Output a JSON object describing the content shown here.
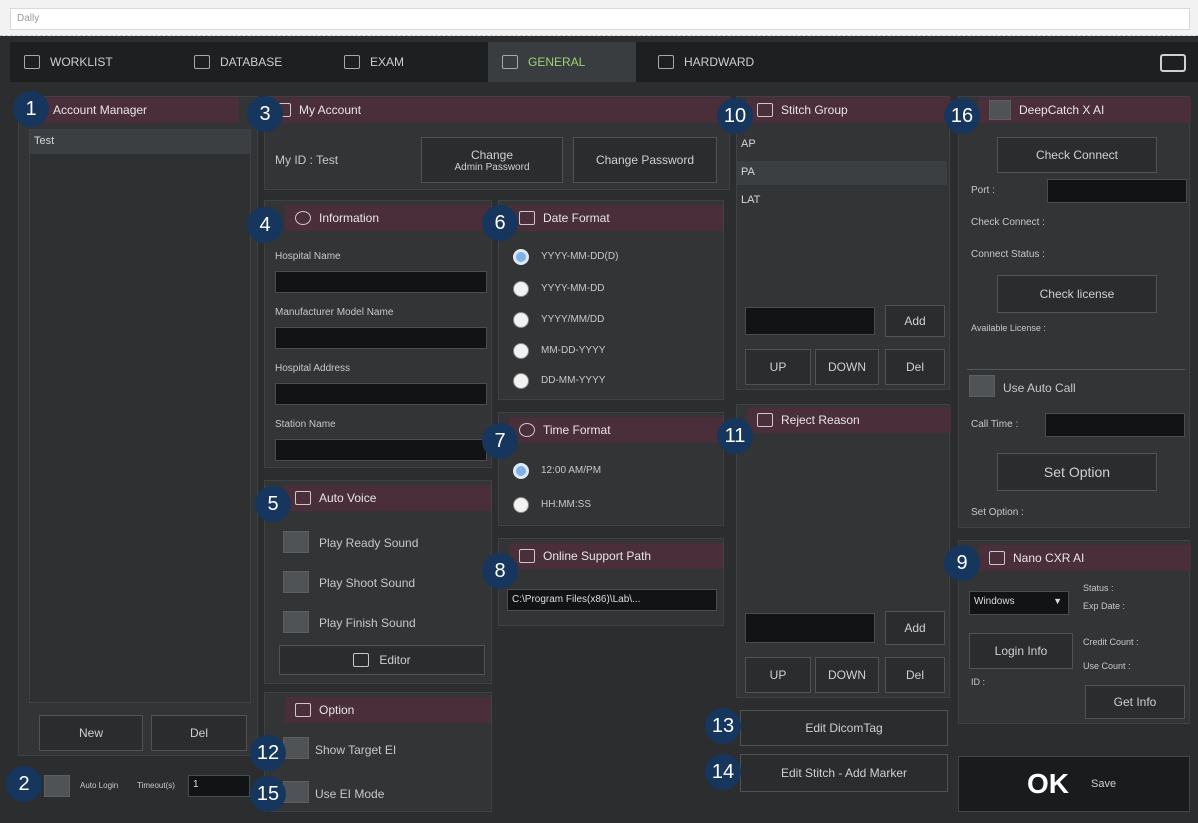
{
  "topbar": {
    "input_text": "Dally"
  },
  "tabs": [
    {
      "label": "WORKLIST"
    },
    {
      "label": "DATABASE"
    },
    {
      "label": "EXAM"
    },
    {
      "label": "GENERAL"
    },
    {
      "label": "HARDWARD"
    }
  ],
  "account_manager": {
    "title": "Account Manager",
    "users": [
      "Test"
    ],
    "new_label": "New",
    "del_label": "Del",
    "auto_login_label": "Auto Login",
    "timeout_label": "Timeout(s)",
    "timeout_value": "1"
  },
  "my_account": {
    "title": "My Account",
    "my_id": "My ID : Test",
    "change_admin_line1": "Change",
    "change_admin_line2": "Admin Password",
    "change_password": "Change Password"
  },
  "information": {
    "title": "Information",
    "hospital_name": "Hospital Name",
    "manufacturer": "Manufacturer Model Name",
    "hospital_address": "Hospital Address",
    "station_name": "Station Name"
  },
  "date_format": {
    "title": "Date Format",
    "options": [
      "YYYY-MM-DD(D)",
      "YYYY-MM-DD",
      "YYYY/MM/DD",
      "MM-DD-YYYY",
      "DD-MM-YYYY"
    ],
    "selected": 0
  },
  "time_format": {
    "title": "Time Format",
    "options": [
      "12:00 AM/PM",
      "HH:MM:SS"
    ],
    "selected": 0
  },
  "online_support": {
    "title": "Online Support Path",
    "path": "C:\\Program Files(x86)\\Lab\\..."
  },
  "auto_voice": {
    "title": "Auto Voice",
    "ready": "Play Ready Sound",
    "shoot": "Play Shoot Sound",
    "finish": "Play Finish Sound",
    "editor": "Editor"
  },
  "option": {
    "title": "Option",
    "show_target": "Show Target EI",
    "use_ei": "Use EI Mode"
  },
  "stitch_group": {
    "title": "Stitch Group",
    "items": [
      "AP",
      "PA",
      "LAT"
    ],
    "add": "Add",
    "up": "UP",
    "down": "DOWN",
    "del": "Del"
  },
  "reject_reason": {
    "title": "Reject Reason",
    "add": "Add",
    "up": "UP",
    "down": "DOWN",
    "del": "Del"
  },
  "edit_dicom_tag": "Edit DicomTag",
  "edit_stitch_marker": "Edit Stitch - Add Marker",
  "deepcatch": {
    "title": "DeepCatch X AI",
    "check_connect": "Check Connect",
    "port": "Port :",
    "check_connect_status": "Check Connect :",
    "connect_status": "Connect Status :",
    "check_license": "Check license",
    "available_license": "Available License :",
    "use_auto_call": "Use Auto Call",
    "call_time": "Call Time :",
    "set_option": "Set Option",
    "set_option_status": "Set Option :"
  },
  "nano": {
    "title": "Nano CXR AI",
    "select": "Windows",
    "status": "Status :",
    "exp_date": "Exp Date :",
    "login_info": "Login Info",
    "credit_count": "Credit Count :",
    "use_count": "Use Count :",
    "id_label": "ID :",
    "get_info": "Get Info"
  },
  "ok": {
    "ok": "OK",
    "save": "Save"
  },
  "badges": [
    "1",
    "2",
    "3",
    "4",
    "5",
    "6",
    "7",
    "8",
    "9",
    "10",
    "11",
    "12",
    "13",
    "14",
    "15",
    "16"
  ],
  "colors": {
    "header_bg": "#4a2e3a",
    "active_tab_text": "#9ed07a",
    "badge_bg": "#16365e"
  }
}
